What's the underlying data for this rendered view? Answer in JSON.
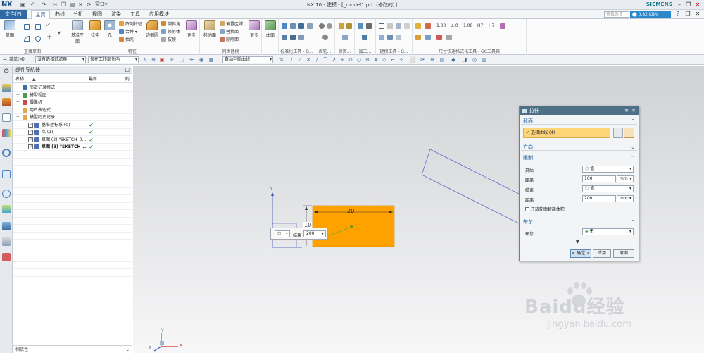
{
  "app": {
    "logo": "NX",
    "title": "NX 10 - 建模 - [_model1.prt（修改的）]",
    "brand": "SIEMENS",
    "window_menu": "窗口"
  },
  "menu": {
    "file": "文件(F)",
    "tabs": [
      "主页",
      "曲线",
      "分析",
      "视图",
      "渲染",
      "工具",
      "应用模块"
    ],
    "active_tab": "主页",
    "search_placeholder": "查找命令",
    "cloud_label": "0.82 KB/s"
  },
  "ribbon": {
    "groups": [
      {
        "label": "直接草图",
        "buttons": [
          "草图"
        ]
      },
      {
        "label": "特征",
        "buttons": [
          "基准平面",
          "拉伸",
          "孔",
          "阵列特征",
          "合并",
          "抽壳",
          "边倒圆",
          "倒斜角",
          "修剪体",
          "拔模",
          "更多"
        ]
      },
      {
        "label": "同步建模",
        "buttons": [
          "移动面",
          "偏置区域",
          "替换面",
          "删除面",
          "更多"
        ]
      },
      {
        "label": "",
        "buttons": [
          "曲面",
          "更多"
        ]
      },
      {
        "label": "标准化工具 - G...",
        "buttons": []
      },
      {
        "label": "齿轮...",
        "buttons": []
      },
      {
        "label": "弹簧...",
        "buttons": []
      },
      {
        "label": "加工...",
        "buttons": []
      },
      {
        "label": "建模工具 - G...",
        "buttons": []
      },
      {
        "label": "尺寸快速格式化工具 - GC工具箱",
        "buttons": []
      }
    ]
  },
  "toolbar": {
    "menu_label": "菜单(M)",
    "filter": "没有选择过滤器",
    "scope": "仅在工作部件内",
    "curve_rule": "自动判断曲线"
  },
  "navigator": {
    "title": "部件导航器",
    "columns": [
      "名称",
      "最新",
      "附"
    ],
    "rows": [
      {
        "label": "历史记录模式",
        "indent": 1,
        "latest": false
      },
      {
        "label": "模型视图",
        "indent": 1,
        "latest": false
      },
      {
        "label": "摄像机",
        "indent": 1,
        "latest": false
      },
      {
        "label": "用户表达式",
        "indent": 1,
        "latest": false
      },
      {
        "label": "模型历史记录",
        "indent": 1,
        "latest": false
      },
      {
        "label": "基准坐标系 (0)",
        "indent": 2,
        "latest": true
      },
      {
        "label": "点 (1)",
        "indent": 2,
        "latest": true
      },
      {
        "label": "草图 (2) \"SKETCH_0...",
        "indent": 2,
        "latest": true
      },
      {
        "label": "草图 (3) \"SKETCH_...",
        "indent": 2,
        "latest": true,
        "bold": true
      }
    ],
    "dependency": "相依性"
  },
  "graphics": {
    "dim_width": "20",
    "dim_height": "10",
    "end_label": "结束",
    "end_value": "200",
    "axis_x": "X",
    "axis_y": "Y",
    "axis_z": "Z",
    "orange": "#ffa200"
  },
  "dialog": {
    "title": "拉伸",
    "section_label": "截面",
    "select_curve": "选择曲线 (4)",
    "direction_label": "方向",
    "limits_label": "限制",
    "start_label": "开始",
    "start_value": "值",
    "distance_label": "距离",
    "start_distance": "100",
    "unit": "mm",
    "end_label": "结束",
    "end_value": "值",
    "end_distance": "200",
    "open_profile": "开放轮廓智能体积",
    "boolean_section": "布尔",
    "boolean_label": "布尔",
    "boolean_value": "无",
    "ok": "< 确定 >",
    "apply": "应用",
    "cancel": "取消"
  },
  "watermark": {
    "brand": "Baidu经验",
    "url": "jingyan.baidu.com"
  }
}
